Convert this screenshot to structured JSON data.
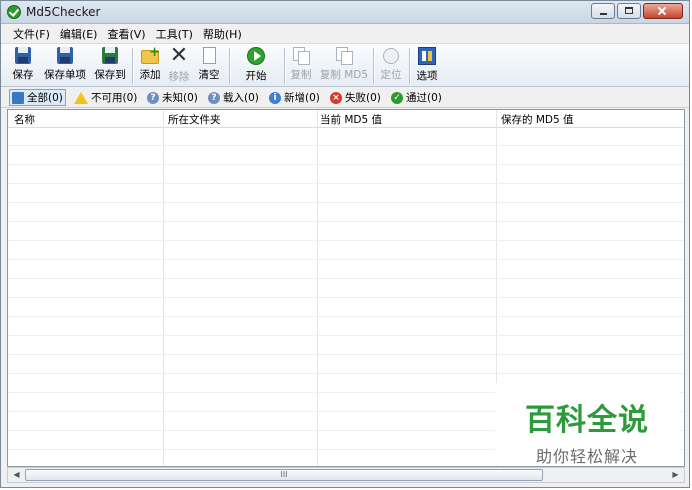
{
  "window": {
    "title": "Md5Checker",
    "controls": [
      "minimize",
      "maximize",
      "close"
    ]
  },
  "menu": [
    "文件(F)",
    "编辑(E)",
    "查看(V)",
    "工具(T)",
    "帮助(H)"
  ],
  "toolbar": {
    "save": "保存",
    "save_item": "保存单项",
    "save_to": "保存到",
    "add": "添加",
    "remove": "移除",
    "clear": "清空",
    "start": "开始",
    "copy": "复制",
    "copy_md5": "复制 MD5",
    "locate": "定位",
    "options": "选项"
  },
  "filters": {
    "all": "全部(0)",
    "unavailable": "不可用(0)",
    "unknown": "未知(0)",
    "loaded": "载入(0)",
    "new": "新增(0)",
    "failed": "失败(0)",
    "passed": "通过(0)"
  },
  "table": {
    "columns": [
      "名称",
      "所在文件夹",
      "当前 MD5 值",
      "保存的 MD5 值"
    ],
    "rows": []
  },
  "scrollbar": {
    "thumb_glyph": "III"
  },
  "watermark": {
    "title": "百科全说",
    "subtitle": "助你轻松解决"
  }
}
